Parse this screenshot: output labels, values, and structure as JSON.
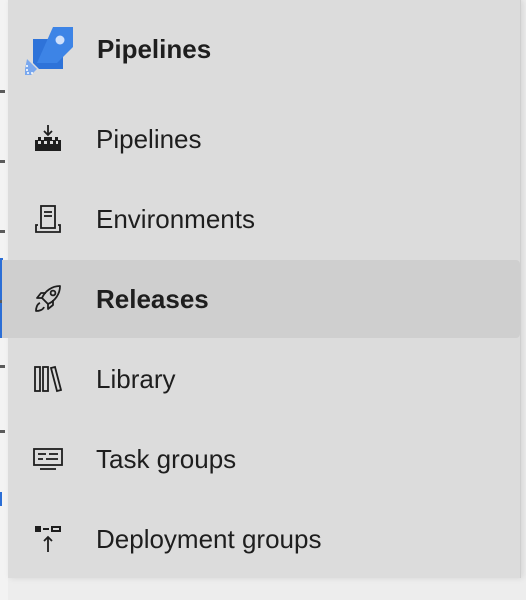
{
  "header": {
    "title": "Pipelines",
    "logo_icon": "azure-pipelines-rocket-logo-icon"
  },
  "nav": {
    "items": [
      {
        "label": "Pipelines",
        "icon": "pipelines-icon",
        "selected": false
      },
      {
        "label": "Environments",
        "icon": "environments-server-icon",
        "selected": false
      },
      {
        "label": "Releases",
        "icon": "rocket-icon",
        "selected": true
      },
      {
        "label": "Library",
        "icon": "library-books-icon",
        "selected": false
      },
      {
        "label": "Task groups",
        "icon": "task-groups-icon",
        "selected": false
      },
      {
        "label": "Deployment groups",
        "icon": "deployment-groups-icon",
        "selected": false
      }
    ]
  },
  "colors": {
    "accent": "#1f6ad6",
    "logo_blue": "#2e73d9",
    "logo_light": "#6fa1ec",
    "text": "#1e1e1e",
    "panel_bg": "#dcdcdc",
    "selected_bg": "#cfcfcf"
  }
}
